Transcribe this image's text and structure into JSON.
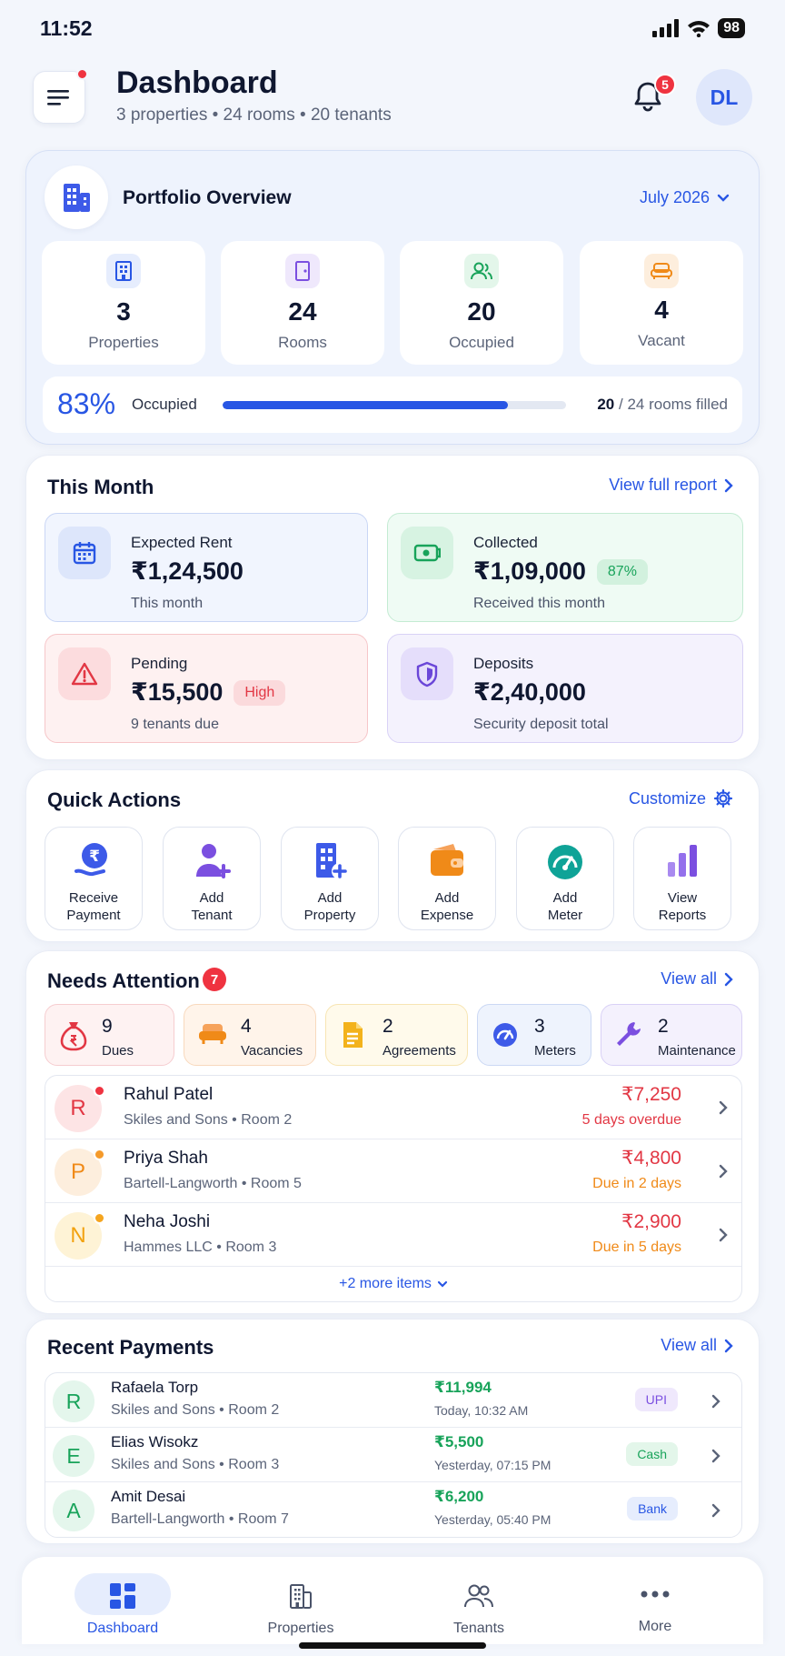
{
  "status_bar": {
    "time": "11:52",
    "battery": "98"
  },
  "header": {
    "title": "Dashboard",
    "subtitle": "3 properties • 24 rooms • 20 tenants",
    "notification_count": "5",
    "avatar_initials": "DL"
  },
  "overview": {
    "title": "Portfolio Overview",
    "period": "July 2026",
    "stats": [
      {
        "value": "3",
        "label": "Properties"
      },
      {
        "value": "24",
        "label": "Rooms"
      },
      {
        "value": "20",
        "label": "Occupied"
      },
      {
        "value": "4",
        "label": "Vacant"
      }
    ],
    "occupancy_pct": "83%",
    "occupancy_label": "Occupied",
    "occupancy_fraction": 0.83,
    "filled": "20",
    "filled_rest": "/ 24 rooms filled"
  },
  "this_month": {
    "title": "This Month",
    "link": "View full report",
    "expected": {
      "title": "Expected Rent",
      "value": "₹1,24,500",
      "sub": "This month"
    },
    "collected": {
      "title": "Collected",
      "value": "₹1,09,000",
      "pill": "87%",
      "sub": "Received this month"
    },
    "pending": {
      "title": "Pending",
      "value": "₹15,500",
      "pill": "High",
      "sub": "9 tenants due"
    },
    "deposits": {
      "title": "Deposits",
      "value": "₹2,40,000",
      "sub": "Security deposit total"
    }
  },
  "quick_actions": {
    "title": "Quick Actions",
    "link": "Customize",
    "items": [
      {
        "l1": "Receive",
        "l2": "Payment"
      },
      {
        "l1": "Add",
        "l2": "Tenant"
      },
      {
        "l1": "Add",
        "l2": "Property"
      },
      {
        "l1": "Add",
        "l2": "Expense"
      },
      {
        "l1": "Add",
        "l2": "Meter"
      },
      {
        "l1": "View",
        "l2": "Reports"
      }
    ]
  },
  "attention": {
    "title": "Needs Attention",
    "count": "7",
    "link": "View all",
    "chips": [
      {
        "n": "9",
        "l": "Dues"
      },
      {
        "n": "4",
        "l": "Vacancies"
      },
      {
        "n": "2",
        "l": "Agreements"
      },
      {
        "n": "3",
        "l": "Meters"
      },
      {
        "n": "2",
        "l": "Maintenance"
      }
    ],
    "rows": [
      {
        "initial": "R",
        "name": "Rahul Patel",
        "property": "Skiles and Sons",
        "room": "Room 2",
        "amount": "₹7,250",
        "due": "5 days overdue"
      },
      {
        "initial": "P",
        "name": "Priya Shah",
        "property": "Bartell-Langworth",
        "room": "Room 5",
        "amount": "₹4,800",
        "due": "Due in 2 days"
      },
      {
        "initial": "N",
        "name": "Neha Joshi",
        "property": "Hammes LLC",
        "room": "Room 3",
        "amount": "₹2,900",
        "due": "Due in 5 days"
      }
    ],
    "more": "+2 more items"
  },
  "payments": {
    "title": "Recent Payments",
    "link": "View all",
    "rows": [
      {
        "initial": "R",
        "name": "Rafaela Torp",
        "property": "Skiles and Sons",
        "room": "Room 2",
        "amount": "₹11,994",
        "time": "Today, 10:32 AM",
        "method": "UPI"
      },
      {
        "initial": "E",
        "name": "Elias Wisokz",
        "property": "Skiles and Sons",
        "room": "Room 3",
        "amount": "₹5,500",
        "time": "Yesterday, 07:15 PM",
        "method": "Cash"
      },
      {
        "initial": "A",
        "name": "Amit Desai",
        "property": "Bartell-Langworth",
        "room": "Room 7",
        "amount": "₹6,200",
        "time": "Yesterday, 05:40 PM",
        "method": "Bank"
      }
    ]
  },
  "nav": [
    {
      "label": "Dashboard"
    },
    {
      "label": "Properties"
    },
    {
      "label": "Tenants"
    },
    {
      "label": "More"
    }
  ],
  "colors": {
    "accent": "#2856e4",
    "danger": "#ef3340",
    "success": "#18a35a",
    "warning": "#f08a18"
  }
}
